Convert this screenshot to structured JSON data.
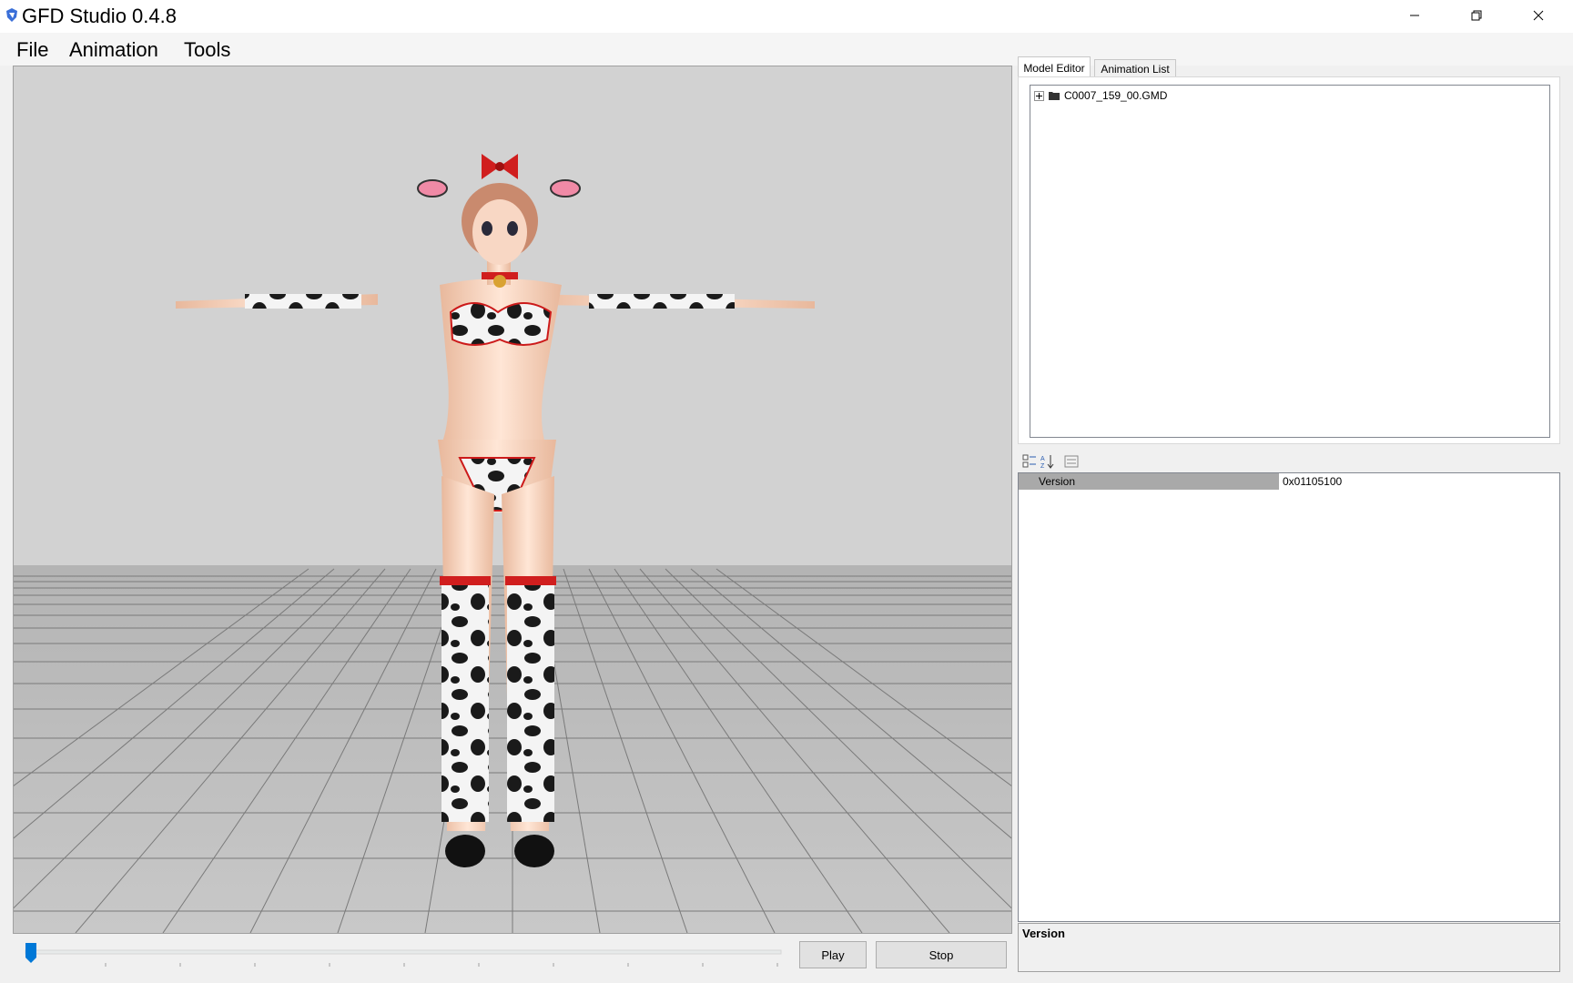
{
  "window": {
    "title": "GFD Studio 0.4.8"
  },
  "menu": {
    "items": [
      "File",
      "Animation",
      "Tools"
    ]
  },
  "playback": {
    "play_label": "Play",
    "stop_label": "Stop",
    "position": 0.0
  },
  "tabs": [
    {
      "label": "Model Editor",
      "active": true
    },
    {
      "label": "Animation List",
      "active": false
    }
  ],
  "tree": {
    "root": {
      "label": "C0007_159_00.GMD",
      "expanded": false
    }
  },
  "properties": {
    "rows": [
      {
        "name": "Version",
        "value": "0x01105100"
      }
    ],
    "description_title": "Version"
  },
  "colors": {
    "accent": "#0078d7",
    "viewport_bg": "#d2d2d2",
    "selected_row": "#a9a9a9"
  }
}
